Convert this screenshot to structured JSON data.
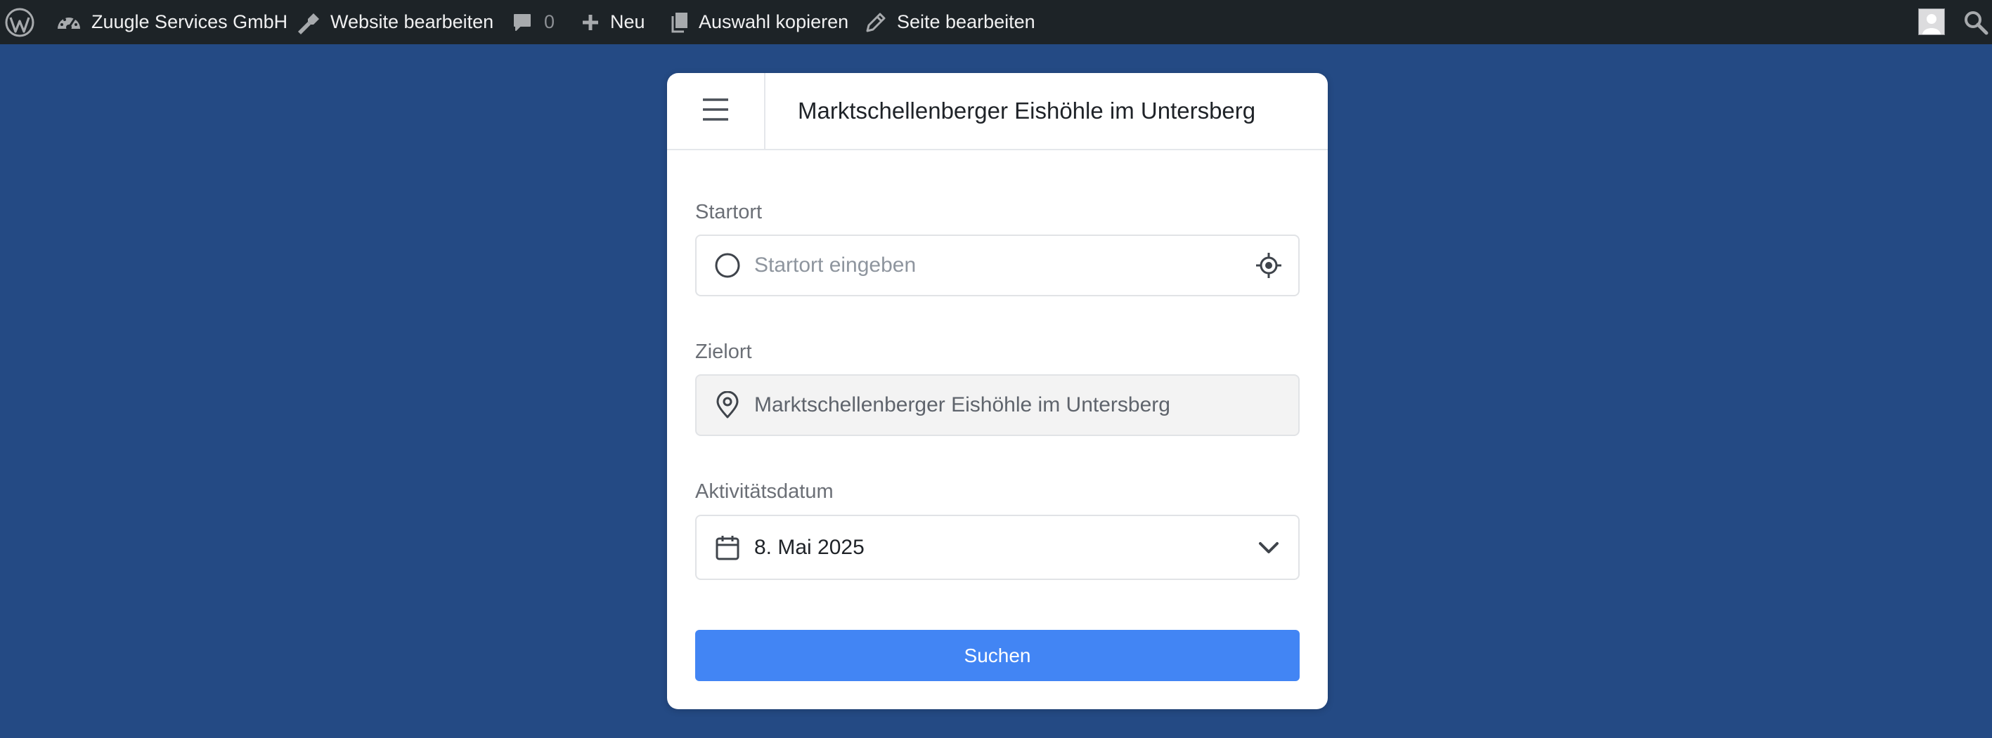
{
  "admin_bar": {
    "wp_logo_icon": "wordpress-logo-icon",
    "site_name": "Zuugle Services GmbH",
    "customize_label": "Website bearbeiten",
    "comments_count": "0",
    "new_label": "Neu",
    "copy_label": "Auswahl kopieren",
    "edit_label": "Seite bearbeiten",
    "avatar_icon": "avatar-icon",
    "search_icon": "search-icon"
  },
  "card": {
    "menu_icon": "hamburger-menu-icon",
    "title": "Marktschellenberger Eishöhle im Untersberg",
    "start": {
      "label": "Startort",
      "placeholder": "Startort eingeben",
      "value": "",
      "icon": "circle-icon",
      "locate_icon": "crosshair-locate-icon"
    },
    "destination": {
      "label": "Zielort",
      "value": "Marktschellenberger Eishöhle im Untersberg",
      "icon": "map-pin-icon"
    },
    "date": {
      "label": "Aktivitätsdatum",
      "value": "8. Mai 2025",
      "icon": "calendar-icon",
      "dropdown_icon": "chevron-down-icon"
    },
    "search_button": "Suchen"
  },
  "colors": {
    "page_background": "#244a84",
    "admin_bar": "#1d2327",
    "primary_button": "#4285f4"
  }
}
